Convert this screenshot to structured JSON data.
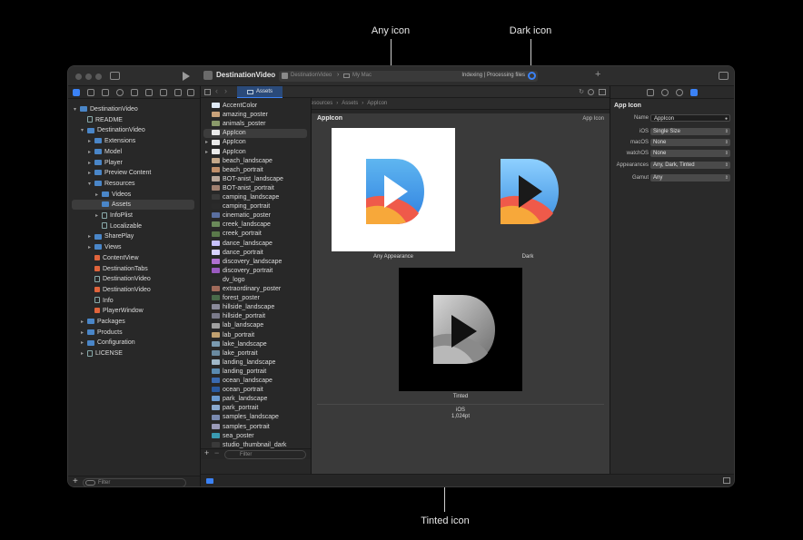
{
  "callouts": {
    "any_icon": "Any icon",
    "dark_icon": "Dark icon",
    "tinted_icon": "Tinted icon"
  },
  "toolbar": {
    "scheme": "DestinationVideo",
    "destination_app": "DestinationVideo",
    "destination_device": "My Mac",
    "status": "Indexing | Processing files"
  },
  "editor_tab": "Assets",
  "jump_bar": [
    "DestinationVideo",
    "DestinationVideo",
    "Resources",
    "Assets",
    "AppIcon"
  ],
  "navigator": {
    "filter_placeholder": "Filter",
    "items": [
      {
        "label": "DestinationVideo",
        "kind": "project",
        "indent": 0,
        "chev": "v"
      },
      {
        "label": "README",
        "kind": "doc",
        "indent": 1,
        "chev": ""
      },
      {
        "label": "DestinationVideo",
        "kind": "folder",
        "indent": 1,
        "chev": "v"
      },
      {
        "label": "Extensions",
        "kind": "folder",
        "indent": 2,
        "chev": ">"
      },
      {
        "label": "Model",
        "kind": "folder",
        "indent": 2,
        "chev": ">"
      },
      {
        "label": "Player",
        "kind": "folder",
        "indent": 2,
        "chev": ">"
      },
      {
        "label": "Preview Content",
        "kind": "folder",
        "indent": 2,
        "chev": ">"
      },
      {
        "label": "Resources",
        "kind": "folder",
        "indent": 2,
        "chev": "v"
      },
      {
        "label": "Videos",
        "kind": "folder",
        "indent": 3,
        "chev": ">"
      },
      {
        "label": "Assets",
        "kind": "folder",
        "indent": 3,
        "chev": "",
        "selected": true
      },
      {
        "label": "InfoPlist",
        "kind": "doc",
        "indent": 3,
        "chev": ">"
      },
      {
        "label": "Localizable",
        "kind": "doc",
        "indent": 3,
        "chev": ""
      },
      {
        "label": "SharePlay",
        "kind": "folder",
        "indent": 2,
        "chev": ">"
      },
      {
        "label": "Views",
        "kind": "folder",
        "indent": 2,
        "chev": ">"
      },
      {
        "label": "ContentView",
        "kind": "swift",
        "indent": 2,
        "chev": ""
      },
      {
        "label": "DestinationTabs",
        "kind": "swift",
        "indent": 2,
        "chev": ""
      },
      {
        "label": "DestinationVideo",
        "kind": "doc",
        "indent": 2,
        "chev": ""
      },
      {
        "label": "DestinationVideo",
        "kind": "swift",
        "indent": 2,
        "chev": ""
      },
      {
        "label": "Info",
        "kind": "doc",
        "indent": 2,
        "chev": ""
      },
      {
        "label": "PlayerWindow",
        "kind": "swift",
        "indent": 2,
        "chev": ""
      },
      {
        "label": "Packages",
        "kind": "folder",
        "indent": 1,
        "chev": ">"
      },
      {
        "label": "Products",
        "kind": "folder",
        "indent": 1,
        "chev": ">"
      },
      {
        "label": "Configuration",
        "kind": "folder",
        "indent": 1,
        "chev": ">"
      },
      {
        "label": "LICENSE",
        "kind": "doc",
        "indent": 1,
        "chev": ">"
      }
    ]
  },
  "assets": {
    "filter_placeholder": "Filter",
    "items": [
      {
        "label": "AccentColor",
        "color": "#dfe9f5",
        "chev": ""
      },
      {
        "label": "amazing_poster",
        "color": "#c9a27a",
        "chev": ""
      },
      {
        "label": "animals_poster",
        "color": "#8a9a6a",
        "chev": ""
      },
      {
        "label": "AppIcon",
        "color": "#eaeaea",
        "chev": "",
        "selected": true
      },
      {
        "label": "AppIcon",
        "color": "#eaeaea",
        "chev": ">"
      },
      {
        "label": "AppIcon",
        "color": "#eaeaea",
        "chev": ">"
      },
      {
        "label": "beach_landscape",
        "color": "#c4a88a",
        "chev": ""
      },
      {
        "label": "beach_portrait",
        "color": "#c08f6a",
        "chev": ""
      },
      {
        "label": "BOT-anist_landscape",
        "color": "#b9a79a",
        "chev": ""
      },
      {
        "label": "BOT-anist_portrait",
        "color": "#a08070",
        "chev": ""
      },
      {
        "label": "camping_landscape",
        "color": "#3a3a3a",
        "chev": ""
      },
      {
        "label": "camping_portrait",
        "color": "#2a2a2a",
        "chev": ""
      },
      {
        "label": "cinematic_poster",
        "color": "#5a6fa0",
        "chev": ""
      },
      {
        "label": "creek_landscape",
        "color": "#6a8a5a",
        "chev": ""
      },
      {
        "label": "creek_portrait",
        "color": "#5a7a4a",
        "chev": ""
      },
      {
        "label": "dance_landscape",
        "color": "#c8c2ff",
        "chev": ""
      },
      {
        "label": "dance_portrait",
        "color": "#d8d2ff",
        "chev": ""
      },
      {
        "label": "discovery_landscape",
        "color": "#b070d0",
        "chev": ""
      },
      {
        "label": "discovery_portrait",
        "color": "#9a5ac0",
        "chev": ""
      },
      {
        "label": "dv_logo",
        "color": "#2a2a2a",
        "chev": ""
      },
      {
        "label": "extraordinary_poster",
        "color": "#a06a5a",
        "chev": ""
      },
      {
        "label": "forest_poster",
        "color": "#4a6a4a",
        "chev": ""
      },
      {
        "label": "hillside_landscape",
        "color": "#8a8a9a",
        "chev": ""
      },
      {
        "label": "hillside_portrait",
        "color": "#7a7a8a",
        "chev": ""
      },
      {
        "label": "lab_landscape",
        "color": "#a0a0a0",
        "chev": ""
      },
      {
        "label": "lab_portrait",
        "color": "#c0a070",
        "chev": ""
      },
      {
        "label": "lake_landscape",
        "color": "#7a9ab0",
        "chev": ""
      },
      {
        "label": "lake_portrait",
        "color": "#6a8aa0",
        "chev": ""
      },
      {
        "label": "landing_landscape",
        "color": "#a0b8c8",
        "chev": ""
      },
      {
        "label": "landing_portrait",
        "color": "#5a8ab0",
        "chev": ""
      },
      {
        "label": "ocean_landscape",
        "color": "#3a6ab0",
        "chev": ""
      },
      {
        "label": "ocean_portrait",
        "color": "#2a5aa0",
        "chev": ""
      },
      {
        "label": "park_landscape",
        "color": "#6a9ad0",
        "chev": ""
      },
      {
        "label": "park_portrait",
        "color": "#8aaad0",
        "chev": ""
      },
      {
        "label": "samples_landscape",
        "color": "#7a8ab0",
        "chev": ""
      },
      {
        "label": "samples_portrait",
        "color": "#9a9ab8",
        "chev": ""
      },
      {
        "label": "sea_poster",
        "color": "#3a9ab0",
        "chev": ""
      },
      {
        "label": "studio_thumbnail_dark",
        "color": "#3a3a3a",
        "chev": ""
      }
    ]
  },
  "editor": {
    "title": "AppIcon",
    "kind_label": "App Icon",
    "wells": {
      "any": "Any Appearance",
      "dark": "Dark",
      "tinted": "Tinted"
    },
    "platform": "iOS",
    "size": "1,024pt"
  },
  "inspector": {
    "section": "App Icon",
    "name_label": "Name",
    "name_value": "AppIcon",
    "rows": [
      {
        "label": "iOS",
        "value": "Single Size"
      },
      {
        "label": "macOS",
        "value": "None"
      },
      {
        "label": "watchOS",
        "value": "None"
      }
    ],
    "appearances_label": "Appearances",
    "appearances_value": "Any, Dark, Tinted",
    "gamut_label": "Gamut",
    "gamut_value": "Any"
  },
  "colors": {
    "accent": "#3b82f6",
    "folder": "#4a86c8"
  }
}
